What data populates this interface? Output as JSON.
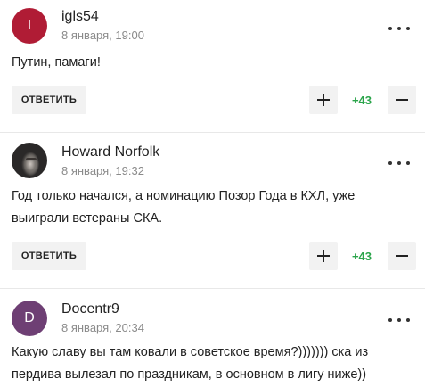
{
  "labels": {
    "reply": "ОТВЕТИТЬ"
  },
  "colors": {
    "accent_positive": "#2aa44a",
    "button_bg": "#f2f2f2"
  },
  "comments": [
    {
      "author": "igls54",
      "date": "8 января, 19:00",
      "avatar_letter": "I",
      "avatar_color": "#b01c35",
      "text": "Путин, памаги!",
      "score": "+43"
    },
    {
      "author": "Howard Norfolk",
      "date": "8 января, 19:32",
      "avatar_letter": "",
      "avatar_color": "#222222",
      "text": "Год только начался, а номинацию Позор Года в КХЛ, уже выиграли ветераны СКА.",
      "score": "+43"
    },
    {
      "author": "Docentr9",
      "date": "8 января, 20:34",
      "avatar_letter": "D",
      "avatar_color": "#6e3f74",
      "text": "Какую славу вы там ковали в советское время?))))))) ска из пердива вылезал по праздникам, в основном в лигу ниже))"
    }
  ]
}
